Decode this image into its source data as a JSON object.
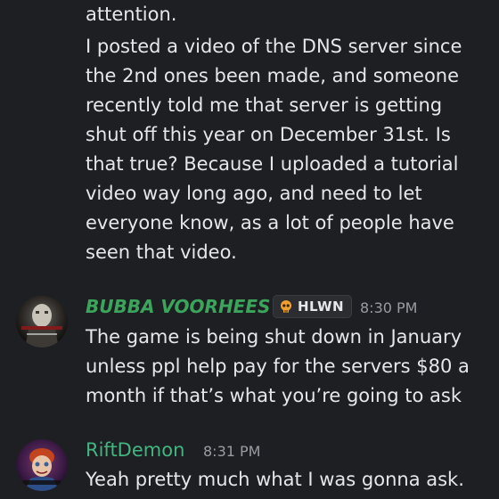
{
  "first_message": {
    "lines": [
      "attention.",
      "I posted a video of the DNS server since",
      "the 2nd ones been made,  and someone",
      "recently told me that server is getting",
      "shut off this year on December 31st. Is",
      "that true? Because I uploaded a tutorial",
      "video way long ago, and need to let",
      "everyone know, as a lot of people have",
      "seen that video."
    ]
  },
  "bubba": {
    "username": "BUBBA VOORHEES",
    "username_color": "#3ba55c",
    "tag": {
      "icon": "skull-icon",
      "text": "HLWN"
    },
    "timestamp": "8:30 PM",
    "lines": [
      "The game is being shut down in January",
      "unless ppl help pay for the servers $80 a",
      "month if that’s what you’re going to ask"
    ]
  },
  "rift": {
    "username": "RiftDemon",
    "username_color": "#43b581",
    "timestamp": "8:31 PM",
    "lines": [
      "Yeah pretty much what I was gonna ask."
    ]
  }
}
